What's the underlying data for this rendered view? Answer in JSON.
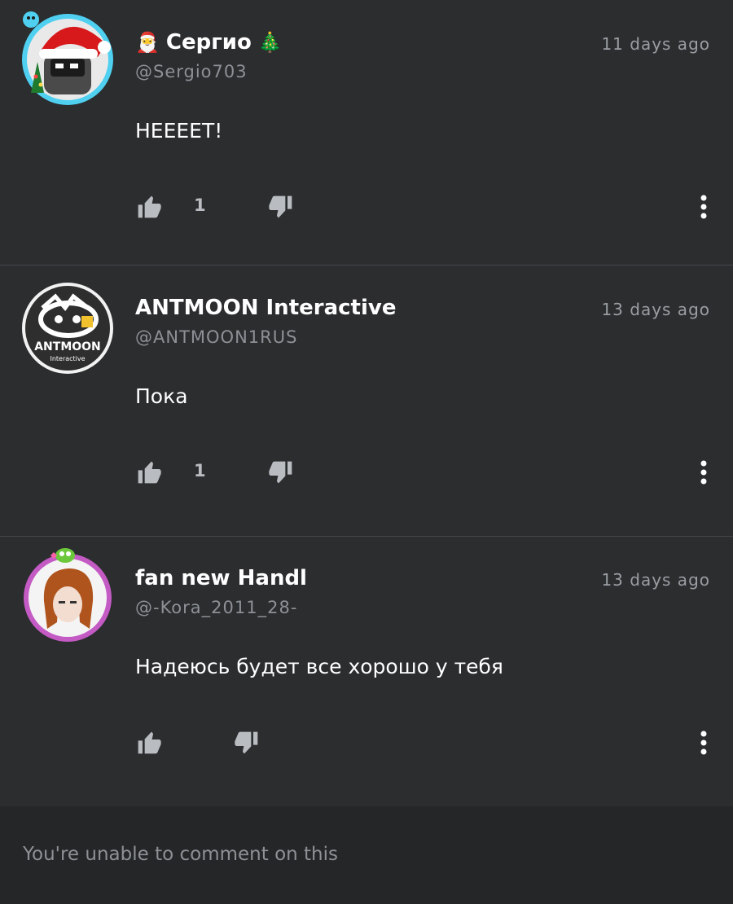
{
  "comments": [
    {
      "name_prefix_emoji": "🎅",
      "display_name": "Сергио",
      "name_suffix_emoji": "🎄",
      "handle": "@Sergio703",
      "time": "11 days ago",
      "text": "НЕЕЕЕТ!",
      "likes": "1",
      "avatar_icon": "santa-hat-avatar"
    },
    {
      "name_prefix_emoji": "",
      "display_name": "ANTMOON Interactive",
      "name_suffix_emoji": "",
      "handle": "@ANTMOON1RUS",
      "time": "13 days ago",
      "text": "Пока",
      "likes": "1",
      "avatar_icon": "antmoon-logo-avatar",
      "avatar_text": "ANTMOON",
      "avatar_subtext": "Interactive"
    },
    {
      "name_prefix_emoji": "",
      "display_name": "fan new Handl",
      "name_suffix_emoji": "",
      "handle": "@-Kora_2011_28-",
      "time": "13 days ago",
      "text": "Надеюсь будет все хорошо у тебя",
      "likes": "",
      "avatar_icon": "anime-girl-avatar"
    }
  ],
  "footer": {
    "text": "You're unable to comment on this"
  },
  "colors": {
    "background": "#2b2d2f",
    "divider": "#45484b",
    "footer_bg": "#242628",
    "muted_text": "#8d9196",
    "icon": "#b9bcc0"
  }
}
